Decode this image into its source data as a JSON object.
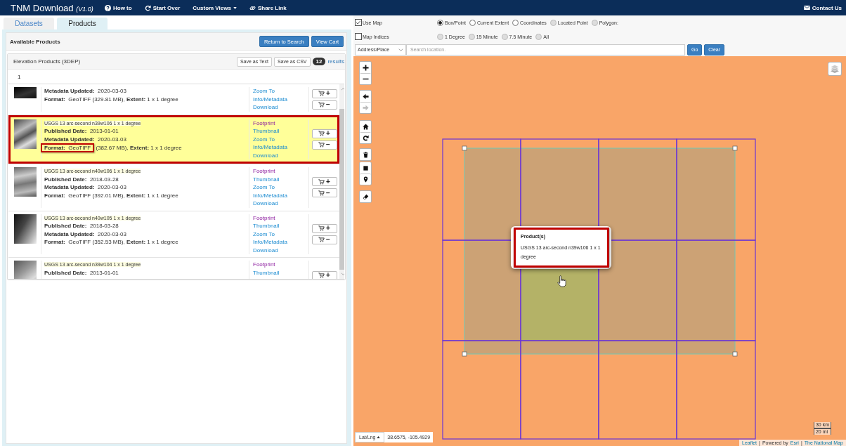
{
  "header": {
    "title": "TNM Download *(V1.0)*",
    "nav": [
      {
        "label": "How to",
        "dropdown": false
      },
      {
        "label": "Start Over",
        "dropdown": false
      },
      {
        "label": "Custom Views",
        "dropdown": true
      },
      {
        "label": "Share Link",
        "dropdown": false
      }
    ],
    "contact": "Contact Us"
  },
  "tabs": [
    {
      "label": "Datasets",
      "selected": false
    },
    {
      "label": "Products",
      "selected": true
    }
  ],
  "products_panel": {
    "title": "Available Products",
    "buttons": [
      "Return to Search",
      "View Cart"
    ],
    "group": {
      "title": "Elevation Products (3DEP)",
      "export_buttons": [
        "Save as Text",
        "Save as CSV"
      ],
      "count": "12",
      "count_label": "results",
      "page": "1",
      "rows": [
        {
          "selected": false,
          "annotated": false,
          "fields": [
            {
              "label": "Metadata Updated:",
              "value": "2020-03-03"
            }
          ],
          "format": {
            "label": "Format:",
            "value": "GeoTIFF",
            "details": "(329.81 MB), **Extent:**  1 x 1 degree",
            "annotated": false
          },
          "links": [
            {
              "label": "Zoom To",
              "visited": false
            },
            {
              "label": "Info/Metadata",
              "visited": false
            },
            {
              "label": "Download",
              "visited": false
            }
          ],
          "cart_buttons": [
            "+",
            "−"
          ]
        },
        {
          "title": "USGS 13 arc-second n39w106 1 x 1 degree",
          "selected": true,
          "annotated": true,
          "fields": [
            {
              "label": "Published Date:",
              "value": "2013-01-01"
            },
            {
              "label": "Metadata Updated:",
              "value": "2020-03-03"
            }
          ],
          "format": {
            "label": "Format:",
            "value": "GeoTIFF",
            "details": "(382.67 MB), **Extent:**  1 x 1 degree",
            "annotated": true
          },
          "links": [
            {
              "label": "Footprint",
              "visited": true
            },
            {
              "label": "Thumbnail",
              "visited": false
            },
            {
              "label": "Zoom To",
              "visited": false
            },
            {
              "label": "Info/Metadata",
              "visited": false
            },
            {
              "label": "Download",
              "visited": false
            }
          ],
          "cart_buttons": [
            "+",
            "−"
          ]
        },
        {
          "title": "USGS 13 arc-second n40w106 1 x 1 degree",
          "selected": false,
          "annotated": false,
          "fields": [
            {
              "label": "Published Date:",
              "value": "2018-03-28"
            },
            {
              "label": "Metadata Updated:",
              "value": "2020-03-03"
            }
          ],
          "format": {
            "label": "Format:",
            "value": "GeoTIFF",
            "details": "(392.01 MB), **Extent:**  1 x 1 degree",
            "annotated": false
          },
          "links": [
            {
              "label": "Footprint",
              "visited": true
            },
            {
              "label": "Thumbnail",
              "visited": false
            },
            {
              "label": "Zoom To",
              "visited": false
            },
            {
              "label": "Info/Metadata",
              "visited": false
            },
            {
              "label": "Download",
              "visited": false
            }
          ],
          "cart_buttons": [
            "+",
            "−"
          ]
        },
        {
          "title": "USGS 13 arc-second n40w105 1 x 1 degree",
          "selected": false,
          "annotated": false,
          "fields": [
            {
              "label": "Published Date:",
              "value": "2018-03-28"
            },
            {
              "label": "Metadata Updated:",
              "value": "2020-03-03"
            }
          ],
          "format": {
            "label": "Format:",
            "value": "GeoTIFF",
            "details": "(352.53 MB), **Extent:**  1 x 1 degree",
            "annotated": false
          },
          "links": [
            {
              "label": "Footprint",
              "visited": true
            },
            {
              "label": "Thumbnail",
              "visited": false
            },
            {
              "label": "Zoom To",
              "visited": false
            },
            {
              "label": "Info/Metadata",
              "visited": false
            },
            {
              "label": "Download",
              "visited": false
            }
          ],
          "cart_buttons": [
            "+",
            "−"
          ]
        },
        {
          "title": "USGS 13 arc-second n39w104 1 x 1 degree",
          "selected": false,
          "annotated": false,
          "fields": [
            {
              "label": "Published Date:",
              "value": "2013-01-01"
            }
          ],
          "links": [
            {
              "label": "Footprint",
              "visited": true
            },
            {
              "label": "Thumbnail",
              "visited": false
            }
          ],
          "cart_buttons": [
            "+"
          ]
        }
      ]
    }
  },
  "map_options": {
    "checkboxes": [
      {
        "label": "Use Map",
        "checked": true
      },
      {
        "label": "Map Indices",
        "checked": false
      }
    ],
    "modes": [
      {
        "label": "Box/Point",
        "selected": true,
        "disabled": false
      },
      {
        "label": "Current Extent",
        "selected": false,
        "disabled": false
      },
      {
        "label": "Coordinates",
        "selected": false,
        "disabled": false
      },
      {
        "label": "Located Point",
        "selected": false,
        "disabled": true
      },
      {
        "label": "Polygon:",
        "selected": false,
        "disabled": true
      }
    ],
    "index_options": [
      {
        "label": "1 Degree",
        "selected": false,
        "disabled": true
      },
      {
        "label": "15 Minute",
        "selected": false,
        "disabled": true
      },
      {
        "label": "7.5 Minute",
        "selected": false,
        "disabled": true
      },
      {
        "label": "All",
        "selected": false,
        "disabled": true
      }
    ]
  },
  "search": {
    "type": "Address/Place",
    "placeholder": "Search location.",
    "buttons": [
      "Go",
      "Clear"
    ]
  },
  "map": {
    "back_disabled": false,
    "forward_disabled": true,
    "popup": {
      "title": "Product(s)",
      "text": "USGS 13 arc-second n39w106 1 x 1 degree",
      "annotated": true
    },
    "coords": {
      "label": "Lat/Lng",
      "value": "38.6575, -105.4929"
    },
    "scale": [
      "30 km",
      "20 mi"
    ],
    "attribution": [
      {
        "text": "Leaflet",
        "kind": "link"
      },
      {
        "text": "|",
        "kind": "separator"
      },
      {
        "text": "Powered by",
        "kind": "text"
      },
      {
        "text": "Esri",
        "kind": "link"
      },
      {
        "text": "|",
        "kind": "separator"
      },
      {
        "text": "The National Map",
        "kind": "link"
      }
    ]
  }
}
